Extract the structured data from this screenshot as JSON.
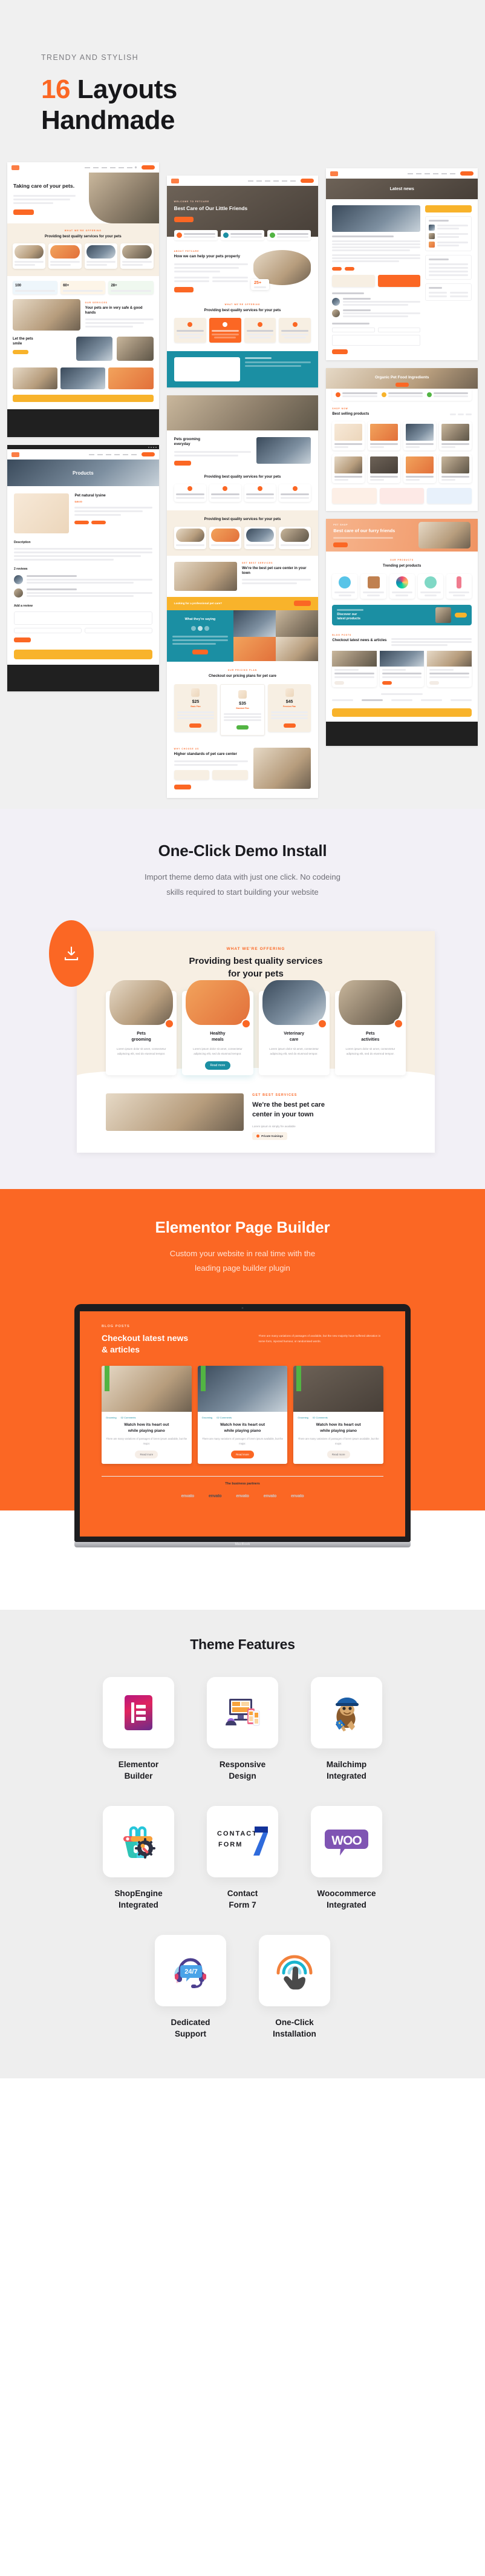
{
  "hero": {
    "eyebrow": "TRENDY AND STYLISH",
    "title_number": "16",
    "title_rest": " Layouts",
    "title_line2": "Handmade"
  },
  "layouts_preview": {
    "shots": [
      {
        "name": "home-pet-care",
        "heading": "Taking care of your pets.",
        "cta": "Read more"
      },
      {
        "name": "services-section",
        "eyebrow": "WHAT WE'RE OFFERING",
        "heading": "Providing best quality services for your pets"
      },
      {
        "name": "about-section",
        "heading": "Your pets are in very safe & good hands"
      },
      {
        "name": "home-best-care",
        "eyebrow": "WELCOME TO PETCARE",
        "heading": "Best Care of Our Little Friends",
        "cta": "Discover more"
      },
      {
        "name": "how-we-help",
        "eyebrow": "ABOUT PETCARE",
        "heading": "How we can help your pets properly",
        "stat": "25+"
      },
      {
        "name": "blog-single",
        "heading": "Latest news"
      },
      {
        "name": "shop-product",
        "heading": "Products",
        "product": "Pet natural lysine",
        "price": "$49.00"
      },
      {
        "name": "pricing-section",
        "eyebrow": "OUR PRICING PLAN",
        "heading": "Checkout our pricing plans for pet care"
      },
      {
        "name": "shop-grid",
        "heading": "Best selling products"
      },
      {
        "name": "trending-products",
        "heading": "Trending pet products"
      }
    ],
    "prices": [
      "$25",
      "$35",
      "$45"
    ],
    "plan_names": [
      "Basic Plan",
      "Standard Plan",
      "Premium Plan"
    ],
    "banner_text": "Looking for a professional pet care?",
    "banner_cta": "Contact us",
    "testimonial_title": "What they're saying",
    "organic_heading": "Organic Pet Food Ingredients",
    "furry_heading": "Best care of our furry friends",
    "news_heading": "Checkout latest news & articles",
    "higher_heading": "Higher standards of pet care center",
    "reviews_label": "2 reviews",
    "add_review_label": "Add a review",
    "description_label": "Description"
  },
  "demo": {
    "title": "One-Click Demo Install",
    "subtitle_l1": "Import theme demo data with just one click. No codeing",
    "subtitle_l2": "skills required to start building your website",
    "badge_icon": "download-icon",
    "mock": {
      "eyebrow": "WHAT WE'RE OFFERING",
      "heading_l1": "Providing best quality services",
      "heading_l2": "for your pets",
      "cards": [
        {
          "title_l1": "Pets",
          "title_l2": "grooming",
          "text": "Lorem ipsum dolor sit amet, consectetur adipiscing elit, sed do eiusmod tempor."
        },
        {
          "title_l1": "Healthy",
          "title_l2": "meals",
          "text": "Lorem ipsum dolor sit amet, consectetur adipiscing elit, sed do eiusmod tempor.",
          "button": "Read more"
        },
        {
          "title_l1": "Veterinary",
          "title_l2": "care",
          "text": "Lorem ipsum dolor sit amet, consectetur adipiscing elit, sed do eiusmod tempor."
        },
        {
          "title_l1": "Pets",
          "title_l2": "activities",
          "text": "Lorem ipsum dolor sit amet, consectetur adipiscing elit, sed do eiusmod tempor."
        }
      ],
      "lower_eyebrow": "GET BEST SERVICES",
      "lower_h_l1": "We're the best pet care",
      "lower_h_l2": "center in your town",
      "lower_p": "Lorem ipsum is simply fre available",
      "lower_tag": "Private trainings"
    }
  },
  "elementor": {
    "title": "Elementor Page Builder",
    "subtitle_l1": "Custom your  website in real time with the",
    "subtitle_l2": "leading page builder plugin",
    "laptop_label": "MacBook",
    "screen": {
      "eyebrow": "BLOG POSTS",
      "heading_l1": "Checkout latest news",
      "heading_l2": "& articles",
      "intro": "There are many variations of passages of available, but the new majority have suffered alteration in some form, injected humour, or randomised words.",
      "posts": [
        {
          "category": "Grooming",
          "comments": "02 Comments",
          "title_l1": "Watch how its heart out",
          "title_l2": "while playing piano",
          "excerpt": "There are many variations of passages of lorem ipsum available, but the major.",
          "button": "Read more"
        },
        {
          "category": "Grooming",
          "comments": "02 Comments",
          "title_l1": "Watch how its heart out",
          "title_l2": "while playing piano",
          "excerpt": "There are many variations of passages of lorem ipsum available, but the major.",
          "button": "Read more"
        },
        {
          "category": "Grooming",
          "comments": "02 Comments",
          "title_l1": "Watch how its heart out",
          "title_l2": "while playing piano",
          "excerpt": "There are many variations of passages of lorem ipsum available, but the major.",
          "button": "Read more"
        }
      ],
      "partners_title": "The business partners",
      "partners": [
        "envato",
        "envato",
        "envato",
        "envato",
        "envato"
      ]
    }
  },
  "features": {
    "title": "Theme Features",
    "rows": [
      [
        {
          "icon": "elementor-icon",
          "label_l1": "Elementor",
          "label_l2": "Builder"
        },
        {
          "icon": "responsive-design-icon",
          "label_l1": "Responsive",
          "label_l2": "Design"
        },
        {
          "icon": "mailchimp-icon",
          "label_l1": "Mailchimp",
          "label_l2": "Integrated"
        }
      ],
      [
        {
          "icon": "shopengine-icon",
          "label_l1": "ShopEngine",
          "label_l2": "Integrated"
        },
        {
          "icon": "contact-form-7-icon",
          "label_l1": "Contact",
          "label_l2": "Form 7"
        },
        {
          "icon": "woocommerce-icon",
          "label_l1": "Woocommerce",
          "label_l2": "Integrated"
        }
      ],
      [
        {
          "icon": "headset-support-icon",
          "label_l1": "Dedicated",
          "label_l2": "Support",
          "badge": "24/7"
        },
        {
          "icon": "one-click-tap-icon",
          "label_l1": "One-Click",
          "label_l2": "Installation"
        }
      ]
    ]
  },
  "colors": {
    "accent": "#fb6724",
    "teal": "#1b8fa3",
    "amber": "#f8b32b",
    "dark": "#202020",
    "cream": "#f7efe3",
    "lilac_bg": "#f2f0f6",
    "grey_bg": "#f0f0f0",
    "feature_bg": "#eeeeee"
  }
}
